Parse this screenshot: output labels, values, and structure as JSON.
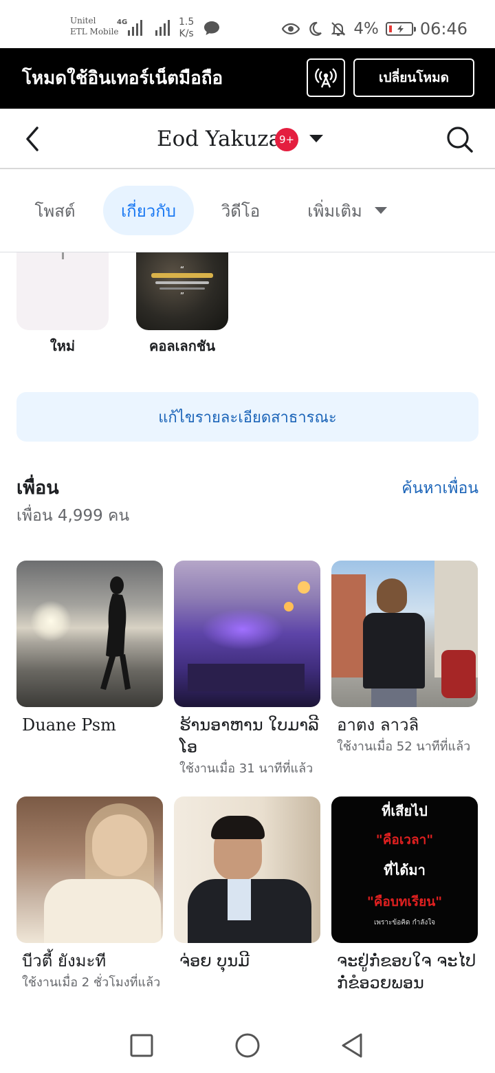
{
  "status_bar": {
    "carrier_line1": "Unitel",
    "carrier_line2": "ETL Mobile",
    "network_type": "4G",
    "speed_value": "1.5",
    "speed_unit": "K/s",
    "battery": "4%",
    "time": "06:46"
  },
  "mode_banner": {
    "title": "โหมดใช้อินเทอร์เน็ตมือถือ",
    "switch_label": "เปลี่ยนโหมด",
    "icon": "broadcast-icon"
  },
  "header": {
    "name": "Eod Yakuza",
    "badge": "9+"
  },
  "tabs": [
    {
      "label": "โพสต์"
    },
    {
      "label": "เกี่ยวกับ"
    },
    {
      "label": "วิดีโอ"
    },
    {
      "label": "เพิ่มเติม"
    }
  ],
  "featured": [
    {
      "label": "ใหม่"
    },
    {
      "label": "คอลเลกชัน"
    }
  ],
  "edit_public_details": "แก้ไขรายละเอียดสาธารณะ",
  "friends": {
    "title": "เพื่อน",
    "find_label": "ค้นหาเพื่อน",
    "count": "เพื่อน 4,999 คน",
    "list": [
      {
        "name": "Duane Psm",
        "status": ""
      },
      {
        "name": "ຮ້ານອາຫານ ໃບມາລີໂອ",
        "status": "ใช้งานเมื่อ 31 นาทีที่แล้ว"
      },
      {
        "name": "อาตง ลาวลิ",
        "status": "ใช้งานเมื่อ 52 นาทีที่แล้ว"
      },
      {
        "name": "บีวตี้ ยังมะที",
        "status": "ใช้งานเมื่อ 2 ชั่วโมงที่แล้ว"
      },
      {
        "name": "ຈ່ອຍ ບຸນມີ",
        "status": ""
      },
      {
        "name": "ຈະຢູ່ກໍ່ຂອບໃຈ ຈະໄປກໍ່ຂໍອວຍພອນ",
        "status": ""
      }
    ],
    "poster_text": {
      "line1": "ที่เสียไป",
      "line2": "\"คือเวลา\"",
      "line3": "ที่ได้มา",
      "line4": "\"คือบทเรียน\"",
      "line5": "เพราะข้อคิด กำลังใจ"
    }
  },
  "colors": {
    "accent": "#1877f2",
    "link": "#1b64b8",
    "tab_active_bg": "#e7f3ff",
    "badge": "#e41e3f"
  }
}
